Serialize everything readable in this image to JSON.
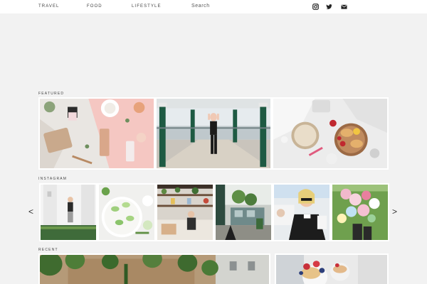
{
  "nav": {
    "items": [
      {
        "label": "TRAVEL"
      },
      {
        "label": "FOOD"
      },
      {
        "label": "LIFESTYLE"
      }
    ],
    "search_label": "Search",
    "social_icons": [
      "instagram-icon",
      "twitter-icon",
      "mail-icon"
    ]
  },
  "sections": {
    "featured_label": "FEATURED",
    "instagram_label": "INSTAGRAM",
    "recent_label": "RECENT"
  },
  "carousel": {
    "prev_label": "<",
    "next_label": ">"
  },
  "colors": {
    "page_bg": "#f2f2f2",
    "header_bg": "#ffffff",
    "accent_pink": "#f7c9c4",
    "accent_green": "#1f5b43"
  }
}
